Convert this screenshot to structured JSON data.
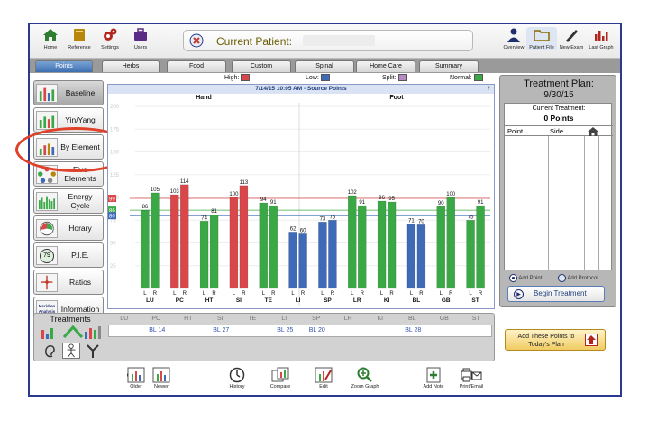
{
  "toolbar": {
    "home": "Home",
    "reference": "Reference",
    "settings": "Settings",
    "users": "Users",
    "patient_label": "Current Patient:",
    "overview": "Overview",
    "patient_file": "Patient File",
    "new_exam": "New Exam",
    "last_graph": "Last Graph"
  },
  "tabs": [
    "Points",
    "Herbs",
    "Food",
    "Custom",
    "Spinal",
    "Home Care",
    "Summary"
  ],
  "sidebar": {
    "items": [
      {
        "label": "Baseline"
      },
      {
        "label": "Yin/Yang"
      },
      {
        "label": "By Element"
      },
      {
        "label": "Five Elements"
      },
      {
        "label": "Energy Cycle"
      },
      {
        "label": "Horary"
      },
      {
        "label": "P.I.E."
      },
      {
        "label": "Ratios"
      },
      {
        "label": "Information"
      }
    ],
    "meridian_thumb": "Meridian Analysis",
    "pie_value": "79"
  },
  "legend": {
    "high": "High:",
    "low": "Low:",
    "split": "Split:",
    "normal": "Normal:",
    "high_color": "#d9474a",
    "low_color": "#3f6ab8",
    "split_color": "#b68ac4",
    "normal_color": "#39a845"
  },
  "chart_data": {
    "type": "bar",
    "title": "7/14/15 10:05 AM - Source Points",
    "groups": [
      "Hand",
      "Foot"
    ],
    "help": "?",
    "categories": [
      "LU",
      "PC",
      "HT",
      "SI",
      "TE",
      "LI",
      "SP",
      "LR",
      "KI",
      "BL",
      "GB",
      "ST"
    ],
    "sides": [
      "L",
      "R"
    ],
    "values": [
      [
        86,
        105
      ],
      [
        103,
        114
      ],
      [
        74,
        81
      ],
      [
        100,
        113
      ],
      [
        94,
        91
      ],
      [
        62,
        60
      ],
      [
        73,
        75
      ],
      [
        102,
        91
      ],
      [
        96,
        95
      ],
      [
        71,
        70
      ],
      [
        90,
        100
      ],
      [
        75,
        91
      ]
    ],
    "colors": [
      "normal",
      "high",
      "normal",
      "high",
      "normal",
      "low",
      "low",
      "normal",
      "normal",
      "low",
      "normal",
      "normal"
    ],
    "reference_lines": [
      {
        "label": "99",
        "color": "high"
      },
      {
        "label": "86",
        "color": "normal"
      },
      {
        "label": "80",
        "color": "low"
      }
    ],
    "y_ticks": [
      "200",
      "175",
      "150",
      "125",
      "100",
      "75",
      "50",
      "25"
    ],
    "ylim": [
      0,
      200
    ]
  },
  "treatment_plan": {
    "title": "Treatment Plan:",
    "date": "9/30/15",
    "current_label": "Current Treatment:",
    "points": "0 Points",
    "col_point": "Point",
    "col_side": "Side",
    "add_point": "Add Point",
    "add_protocol": "Add Protocol",
    "begin": "Begin Treatment"
  },
  "treatments": {
    "label": "Treatments",
    "meridians": [
      "LU",
      "PC",
      "HT",
      "SI",
      "TE",
      "LI",
      "SP",
      "LR",
      "KI",
      "BL",
      "GB",
      "ST"
    ],
    "points": [
      {
        "col": "PC",
        "text": "BL 14"
      },
      {
        "col": "SI",
        "text": "BL 27"
      },
      {
        "col": "LI",
        "text": "BL 25"
      },
      {
        "col": "SP",
        "text": "BL 20"
      },
      {
        "col": "BL",
        "text": "BL 28"
      }
    ],
    "add_button": "Add These Points to Today's Plan"
  },
  "bottom": {
    "older": "Older",
    "newer": "Newer",
    "history": "History",
    "compare": "Compare",
    "edit": "Edit",
    "zoom": "Zoom Graph",
    "add_note": "Add Note",
    "print_email": "Print/Email"
  }
}
